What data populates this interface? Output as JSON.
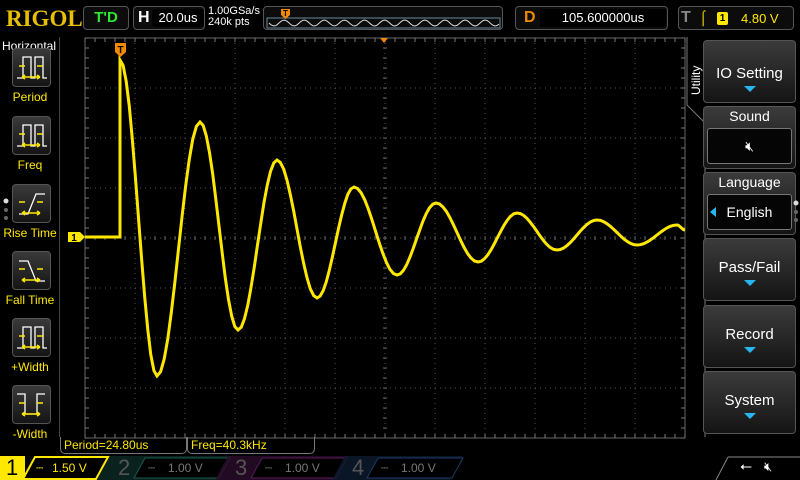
{
  "header": {
    "logo": "RIGOL",
    "run_status": "T'D",
    "horizontal_label": "H",
    "timebase": "20.0us",
    "sample_rate": "1.00GSa/s",
    "memory_depth": "240k pts",
    "delay_label": "D",
    "delay": "105.600000us",
    "trigger_label": "T",
    "trigger_edge_icon": "rising-edge",
    "trigger_source": "1",
    "trigger_level": "4.80 V"
  },
  "left_menu": {
    "title": "Horizontal",
    "items": [
      {
        "label": "Period",
        "icon": "period-icon"
      },
      {
        "label": "Freq",
        "icon": "freq-icon"
      },
      {
        "label": "Rise Time",
        "icon": "rise-time-icon"
      },
      {
        "label": "Fall Time",
        "icon": "fall-time-icon"
      },
      {
        "label": "+Width",
        "icon": "pos-width-icon"
      },
      {
        "label": "-Width",
        "icon": "neg-width-icon"
      }
    ]
  },
  "right_menu": {
    "title": "Utility",
    "io_setting": "IO Setting",
    "sound": "Sound",
    "sound_icon": "speaker-muted",
    "language": "Language",
    "language_value": "English",
    "pass_fail": "Pass/Fail",
    "record": "Record",
    "system": "System"
  },
  "measurements": {
    "period": "Period=24.80us",
    "freq": "Freq=40.3kHz"
  },
  "channels": [
    {
      "num": "1",
      "scale": "1.50 V",
      "color": "#ffe800",
      "active": true
    },
    {
      "num": "2",
      "scale": "1.00 V",
      "color": "#1a6b5c"
    },
    {
      "num": "3",
      "scale": "1.00 V",
      "color": "#6a1a6a"
    },
    {
      "num": "4",
      "scale": "1.00 V",
      "color": "#1a3a6a"
    }
  ],
  "markers": {
    "trigger_marker": "T",
    "channel_marker": "1"
  },
  "colors": {
    "trace": "#ffe800",
    "trigger": "#f08a00",
    "accent": "#27b6f0"
  }
}
